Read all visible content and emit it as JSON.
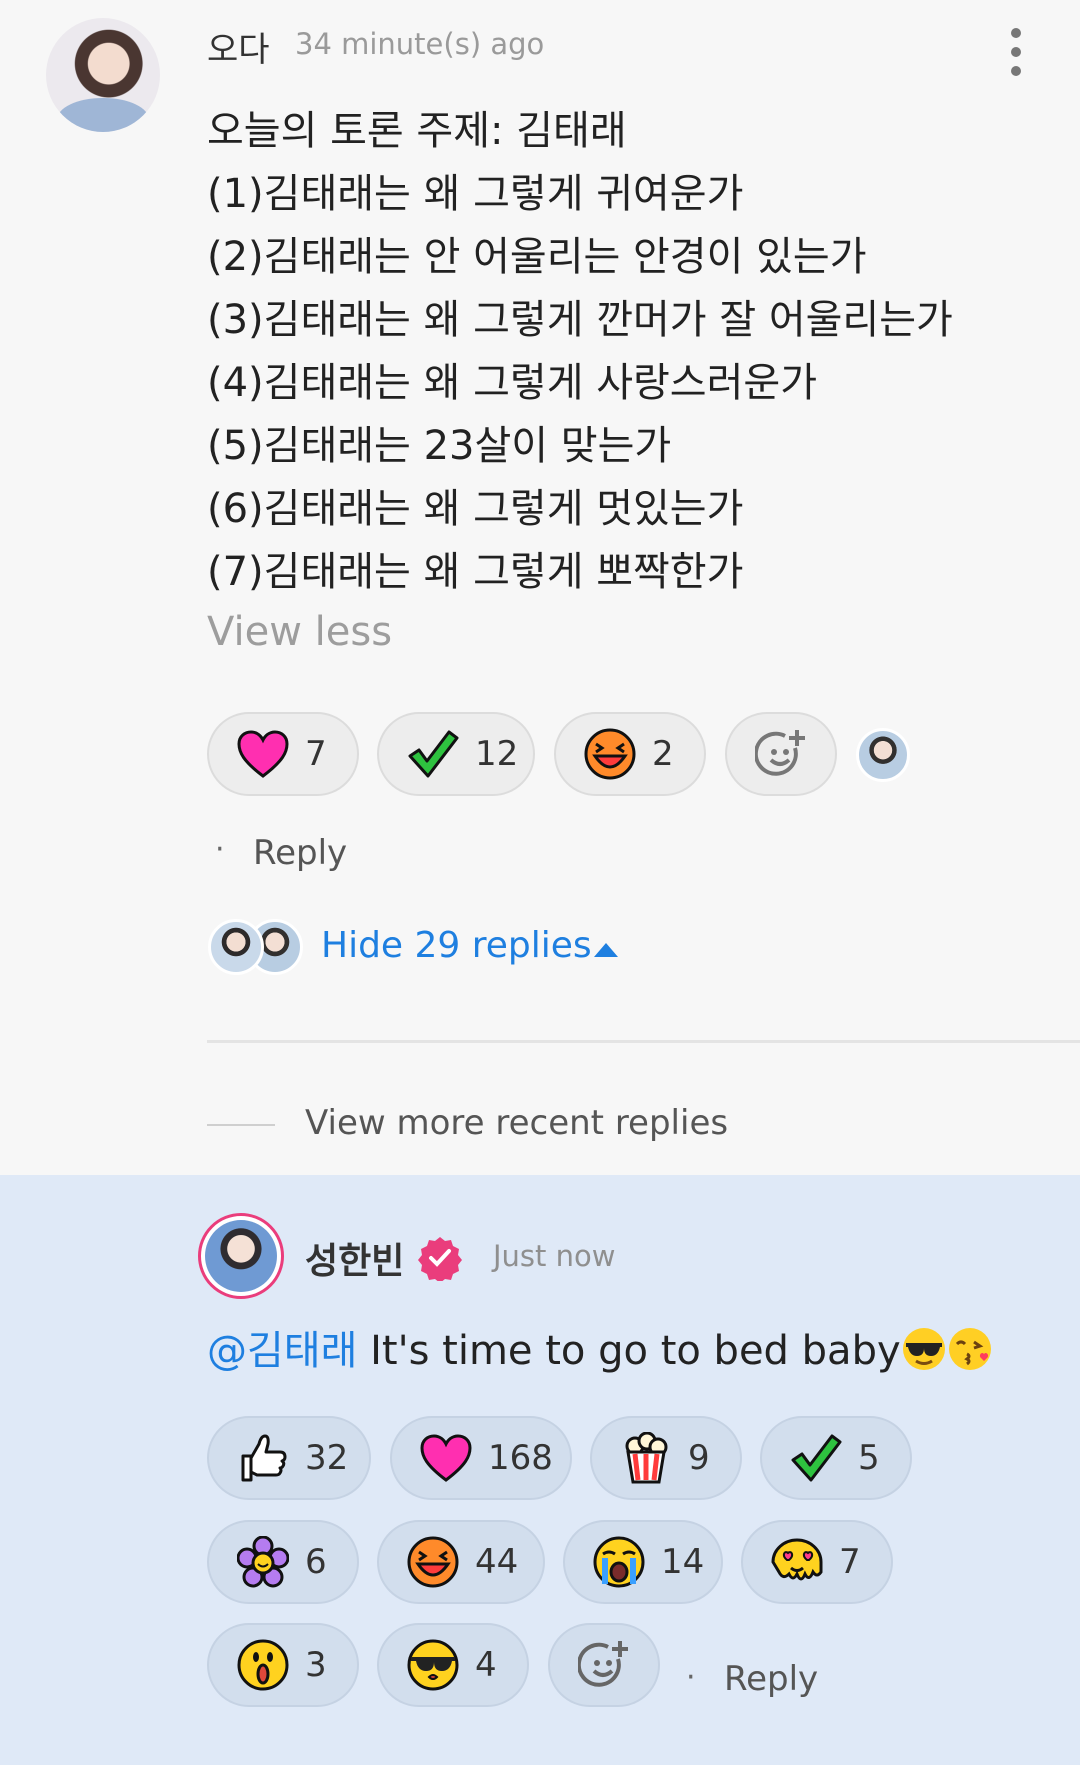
{
  "comment": {
    "username": "오다",
    "timestamp": "34 minute(s) ago",
    "lines": [
      "오늘의 토론 주제: 김태래",
      "(1)김태래는 왜 그렇게 귀여운가",
      "(2)김태래는 안 어울리는 안경이 있는가",
      "(3)김태래는 왜 그렇게 깐머가 잘 어울리는가",
      "(4)김태래는 왜 그렇게 사랑스러운가",
      "(5)김태래는 23살이 맞는가",
      "(6)김태래는 왜 그렇게 멋있는가",
      "(7)김태래는 왜 그렇게 뽀짝한가"
    ],
    "view_less": "View less",
    "reactions": [
      {
        "icon": "heart-icon",
        "count": "7"
      },
      {
        "icon": "check-icon",
        "count": "12"
      },
      {
        "icon": "laughing-face-icon",
        "count": "2"
      }
    ],
    "reply_label": "Reply",
    "hide_replies": "Hide 29 replies"
  },
  "view_more_recent": "View more recent replies",
  "reply": {
    "username": "성한빈",
    "timestamp": "Just now",
    "mention": "@김태래",
    "text": " It's time to go to bed baby",
    "reactions": [
      {
        "icon": "thumbs-up-icon",
        "count": "32"
      },
      {
        "icon": "heart-icon",
        "count": "168"
      },
      {
        "icon": "popcorn-icon",
        "count": "9"
      },
      {
        "icon": "check-icon",
        "count": "5"
      },
      {
        "icon": "flower-icon",
        "count": "6"
      },
      {
        "icon": "laughing-face-icon",
        "count": "44"
      },
      {
        "icon": "crying-face-icon",
        "count": "14"
      },
      {
        "icon": "heart-eyes-melting-icon",
        "count": "7"
      },
      {
        "icon": "shocked-face-icon",
        "count": "3"
      },
      {
        "icon": "kissing-sunglasses-icon",
        "count": "4"
      }
    ],
    "reply_label": "Reply"
  },
  "colors": {
    "link_blue": "#1e7fe0",
    "highlight_bg": "#dfe9f7",
    "verified_pink": "#ea3d7c",
    "heart_pink": "#ff2fb0",
    "check_green": "#2ec23f",
    "face_orange": "#ff8a2a",
    "face_yellow": "#ffd21f"
  }
}
